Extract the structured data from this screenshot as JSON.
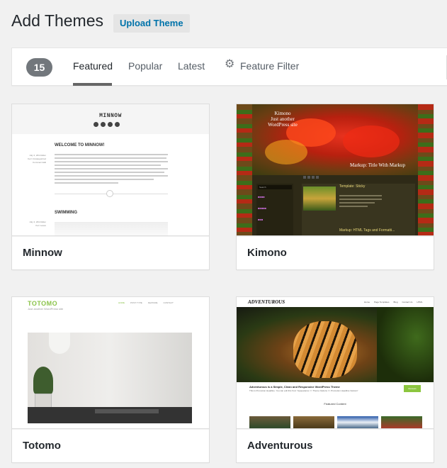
{
  "page": {
    "title": "Add Themes",
    "upload_button": "Upload Theme"
  },
  "filter_bar": {
    "count": "15",
    "tabs": [
      "Featured",
      "Popular",
      "Latest"
    ],
    "active_tab": "Featured",
    "feature_filter": "Feature Filter"
  },
  "themes": [
    {
      "name": "Minnow",
      "preview": {
        "site_title": "MINNOW",
        "post_title": "WELCOME TO MINNOW!",
        "meta": "July 4, 2014 Ellen Kerr Uncategorized Comment Edit",
        "section_title": "SWIMMING",
        "meta2": "July 4, 2014 Ellen Kerr Leave"
      }
    },
    {
      "name": "Kimono",
      "preview": {
        "site_title": "Kimono",
        "tagline": "Just another WordPress site",
        "slide_caption": "Markup: Title With Markup",
        "search_placeholder": "Search",
        "post_title": "Template: Sticky",
        "post2_title": "Markup: HTML Tags and Formatti..."
      }
    },
    {
      "name": "Totomo",
      "preview": {
        "site_title": "TOTOMO",
        "tagline": "Just another WordPress site",
        "nav": [
          "HOME",
          "POST TYPE",
          "FEATURE",
          "CONTACT"
        ]
      }
    },
    {
      "name": "Adventurous",
      "preview": {
        "site_title": "ADVENTUROUS",
        "nav": [
          "Home",
          "Page Templates",
          "Blog",
          "Contact Us",
          "HTML"
        ],
        "headline": "Adventurous is a Simple, Clean and Responsive WordPress Theme",
        "subline": "This is Promotion Headline. You can edit this from \"Appearance => Theme Options => Promotion Headline Options\"",
        "button": "Reviews",
        "featured_title": "Featured Content"
      }
    }
  ],
  "colors": {
    "accent_link": "#0073aa",
    "badge_bg": "#72777c",
    "totomo_green": "#8bc34a",
    "adventurous_green": "#8cc63f"
  },
  "icons": {
    "feature_filter": "gear-icon"
  }
}
